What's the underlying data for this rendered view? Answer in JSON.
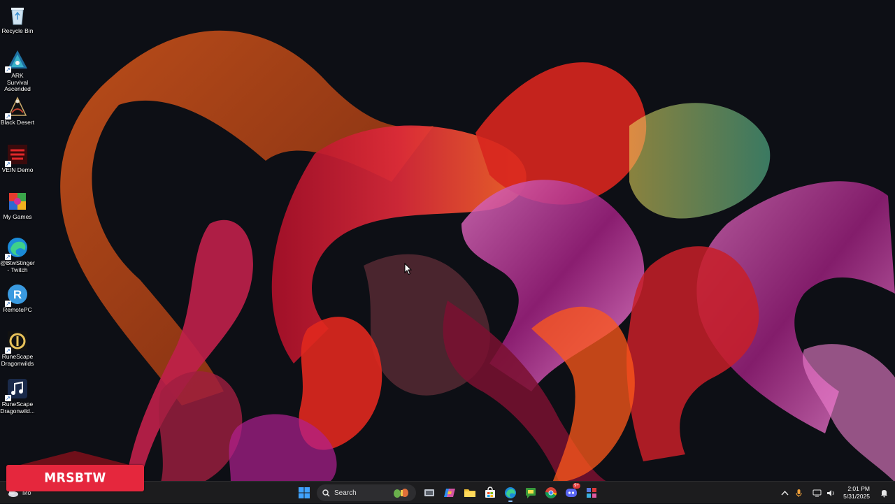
{
  "desktop": {
    "icons": [
      {
        "label": "Recycle Bin",
        "icon": "recycle-bin-icon"
      },
      {
        "label": "ARK Survival Ascended",
        "icon": "ark-icon"
      },
      {
        "label": "Black Desert",
        "icon": "black-desert-icon"
      },
      {
        "label": "VEIN Demo",
        "icon": "vein-icon"
      },
      {
        "label": "My Games",
        "icon": "my-games-icon"
      },
      {
        "label": "@BtwStinger - Twitch",
        "icon": "edge-icon"
      },
      {
        "label": "RemotePC",
        "icon": "remotepc-icon"
      },
      {
        "label": "RuneScape Dragonwilds",
        "icon": "runescape-icon"
      },
      {
        "label": "RuneScape Dragonwild...",
        "icon": "music-icon"
      }
    ]
  },
  "overlay": {
    "text": "MRSBTW",
    "color": "#e5273d"
  },
  "taskbar": {
    "widget_text": "Mo",
    "search_placeholder": "Search",
    "apps": [
      "task-view-icon",
      "copilot-icon",
      "file-explorer-icon",
      "store-icon",
      "edge-icon",
      "chat-app-icon",
      "chrome-icon",
      "discord-icon",
      "app-grid-icon"
    ],
    "discord_badge": "9+",
    "clock": {
      "time": "2:01 PM",
      "date": "5/31/2025"
    }
  }
}
